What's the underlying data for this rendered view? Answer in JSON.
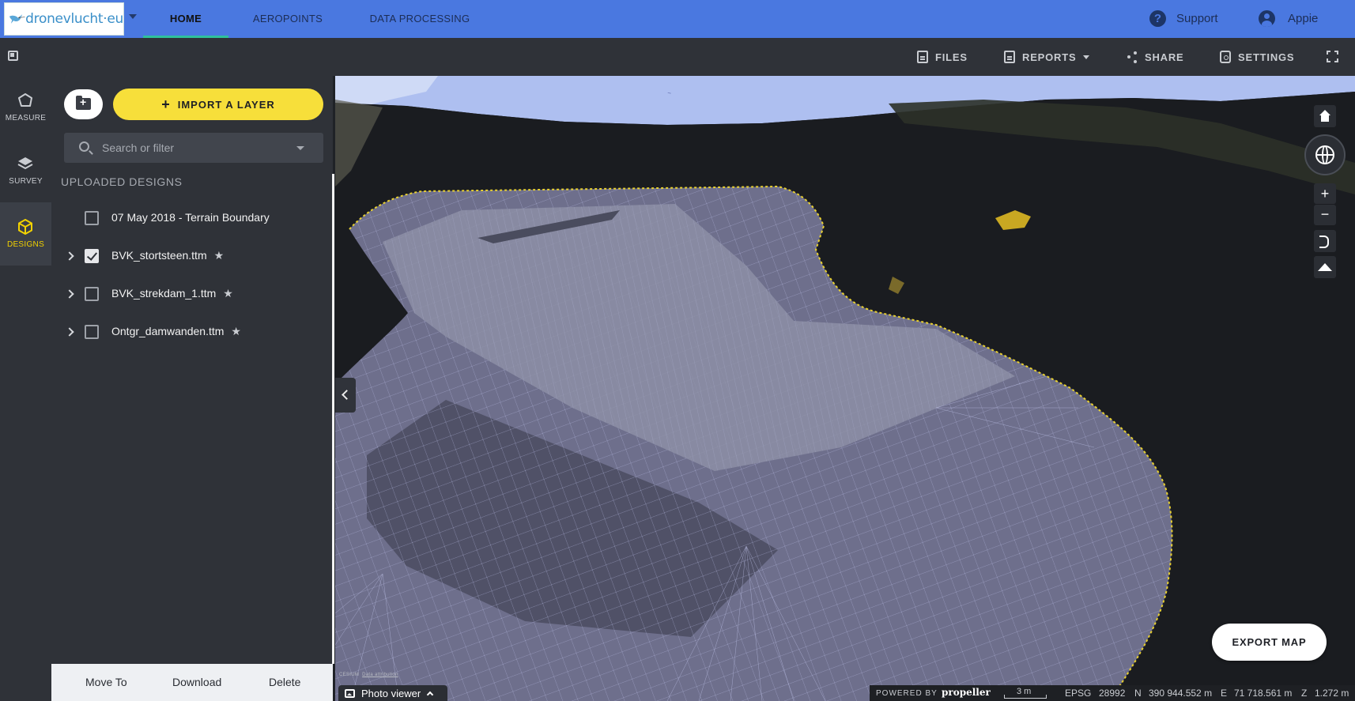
{
  "app": {
    "logo_text": "dronevlucht·eu"
  },
  "topnav": {
    "tabs": [
      {
        "label": "HOME",
        "active": true
      },
      {
        "label": "AEROPOINTS",
        "active": false
      },
      {
        "label": "DATA PROCESSING",
        "active": false
      }
    ],
    "support_label": "Support",
    "user_label": "Appie"
  },
  "toolbar": {
    "files_label": "FILES",
    "reports_label": "REPORTS",
    "share_label": "SHARE",
    "settings_label": "SETTINGS"
  },
  "rail": {
    "items": [
      {
        "label": "MEASURE",
        "icon": "measure-icon",
        "active": false
      },
      {
        "label": "SURVEY",
        "icon": "layers-icon",
        "active": false
      },
      {
        "label": "DESIGNS",
        "icon": "cube-icon",
        "active": true
      }
    ]
  },
  "panel": {
    "import_label": "IMPORT A LAYER",
    "search_placeholder": "Search or filter",
    "section_title": "UPLOADED DESIGNS",
    "designs": [
      {
        "name": "07 May 2018 - Terrain Boundary",
        "checked": false,
        "expandable": false,
        "starred": false
      },
      {
        "name": "BVK_stortsteen.ttm",
        "checked": true,
        "expandable": true,
        "starred": true
      },
      {
        "name": "BVK_strekdam_1.ttm",
        "checked": false,
        "expandable": true,
        "starred": true
      },
      {
        "name": "Ontgr_damwanden.ttm",
        "checked": false,
        "expandable": true,
        "starred": true
      }
    ],
    "bottom_actions": {
      "move_to": "Move To",
      "download": "Download",
      "delete": "Delete"
    }
  },
  "map": {
    "export_label": "EXPORT MAP",
    "cesium_credit": "CESIUM",
    "data_attribution": "Data attribution",
    "photo_viewer_label": "Photo viewer",
    "powered_by": "POWERED BY",
    "propeller_brand": "propeller",
    "scale_label": "3 m",
    "epsg_label": "EPSG",
    "epsg_code": "28992",
    "n_label": "N",
    "n_value": "390 944.552 m",
    "e_label": "E",
    "e_value": "71 718.561 m",
    "z_label": "Z",
    "z_value": "1.272 m"
  },
  "colors": {
    "nav_blue": "#4a78e0",
    "accent_yellow": "#f7df3a",
    "active_tab_underline": "#2fc19b",
    "designs_active": "#f2d200"
  }
}
